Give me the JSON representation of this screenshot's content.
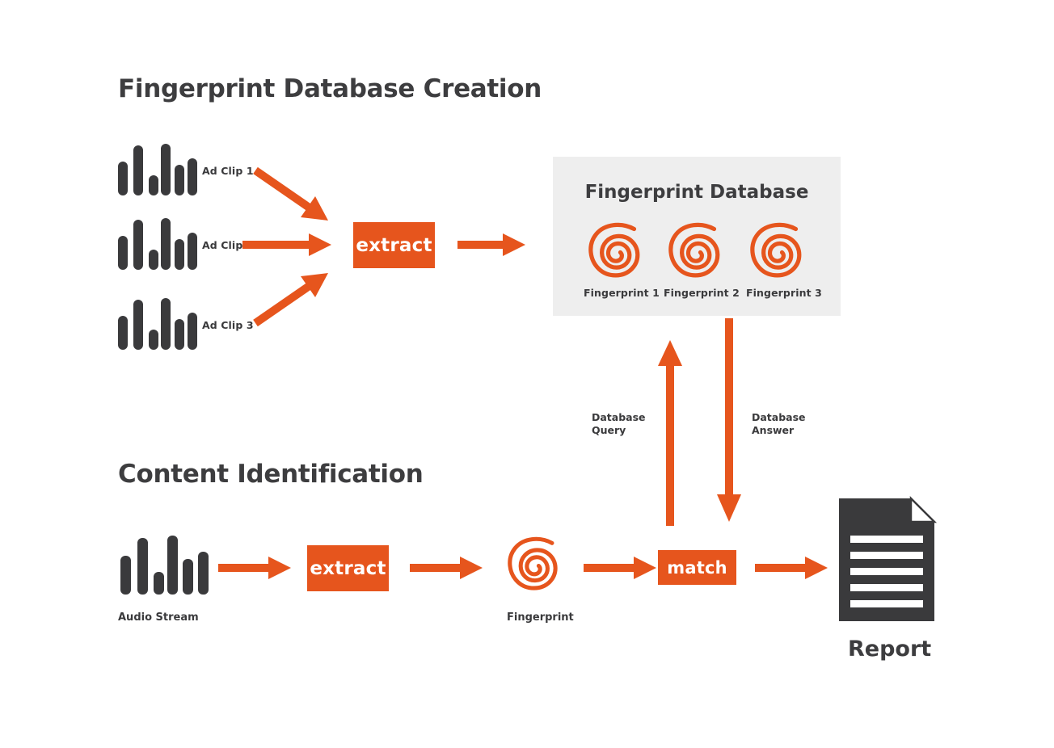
{
  "colors": {
    "accent_orange": "#e6551d",
    "dark_gray": "#3a3a3c",
    "panel_gray": "#eeeeee",
    "background": "#ffffff",
    "white": "#ffffff"
  },
  "sections": {
    "creation": {
      "title": "Fingerprint Database Creation"
    },
    "identification": {
      "title": "Content Identification"
    }
  },
  "creation": {
    "inputs": [
      {
        "label": "Ad Clip 1",
        "icon": "audio-waveform-icon"
      },
      {
        "label": "Ad Clip 2",
        "icon": "audio-waveform-icon"
      },
      {
        "label": "Ad Clip 3",
        "icon": "audio-waveform-icon"
      }
    ],
    "extract_label": "extract",
    "database": {
      "title": "Fingerprint Database",
      "items": [
        {
          "label": "Fingerprint 1",
          "icon": "spiral-fingerprint-icon"
        },
        {
          "label": "Fingerprint 2",
          "icon": "spiral-fingerprint-icon"
        },
        {
          "label": "Fingerprint 3",
          "icon": "spiral-fingerprint-icon"
        }
      ]
    }
  },
  "identification": {
    "audio_stream_label": "Audio Stream",
    "extract_label": "extract",
    "fingerprint_label": "Fingerprint",
    "match_label": "match",
    "report_label": "Report"
  },
  "flows": {
    "query": {
      "line1": "Database",
      "line2": "Query",
      "direction": "up"
    },
    "answer": {
      "line1": "Database",
      "line2": "Answer",
      "direction": "down"
    }
  },
  "waveform_bars": [
    38,
    56,
    22,
    58,
    34,
    42
  ],
  "report_line_count": 5
}
